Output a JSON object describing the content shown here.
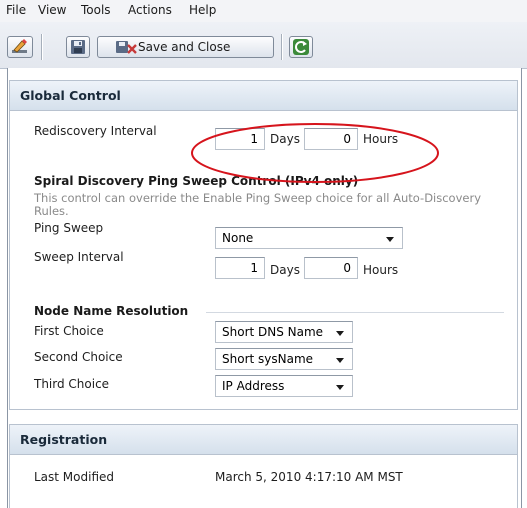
{
  "menu": [
    "File",
    "View",
    "Tools",
    "Actions",
    "Help"
  ],
  "toolbar": {
    "save_close_label": "Save and Close"
  },
  "global_control": {
    "title": "Global Control",
    "rediscovery": {
      "label": "Rediscovery Interval",
      "days": "1",
      "days_unit": "Days",
      "hours": "0",
      "hours_unit": "Hours"
    },
    "spiral": {
      "title": "Spiral Discovery Ping Sweep Control (IPv4 only)",
      "description_1": "This control can override the Enable Ping Sweep choice for all Auto-Discovery",
      "description_2": "Rules.",
      "ping_sweep_label": "Ping Sweep",
      "ping_sweep_value": "None",
      "sweep_interval_label": "Sweep Interval",
      "sweep_days": "1",
      "sweep_days_unit": "Days",
      "sweep_hours": "0",
      "sweep_hours_unit": "Hours"
    },
    "node_name": {
      "title": "Node Name Resolution",
      "first_label": "First Choice",
      "first_value": "Short DNS Name",
      "second_label": "Second Choice",
      "second_value": "Short sysName",
      "third_label": "Third Choice",
      "third_value": "IP Address"
    }
  },
  "registration": {
    "title": "Registration",
    "last_modified_label": "Last Modified",
    "last_modified_value": "March 5, 2010 4:17:10 AM MST"
  },
  "colors": {
    "annotation_oval": "#d6141c",
    "header_gradient_top": "#eef3f9",
    "header_gradient_bottom": "#d5e0ec"
  }
}
